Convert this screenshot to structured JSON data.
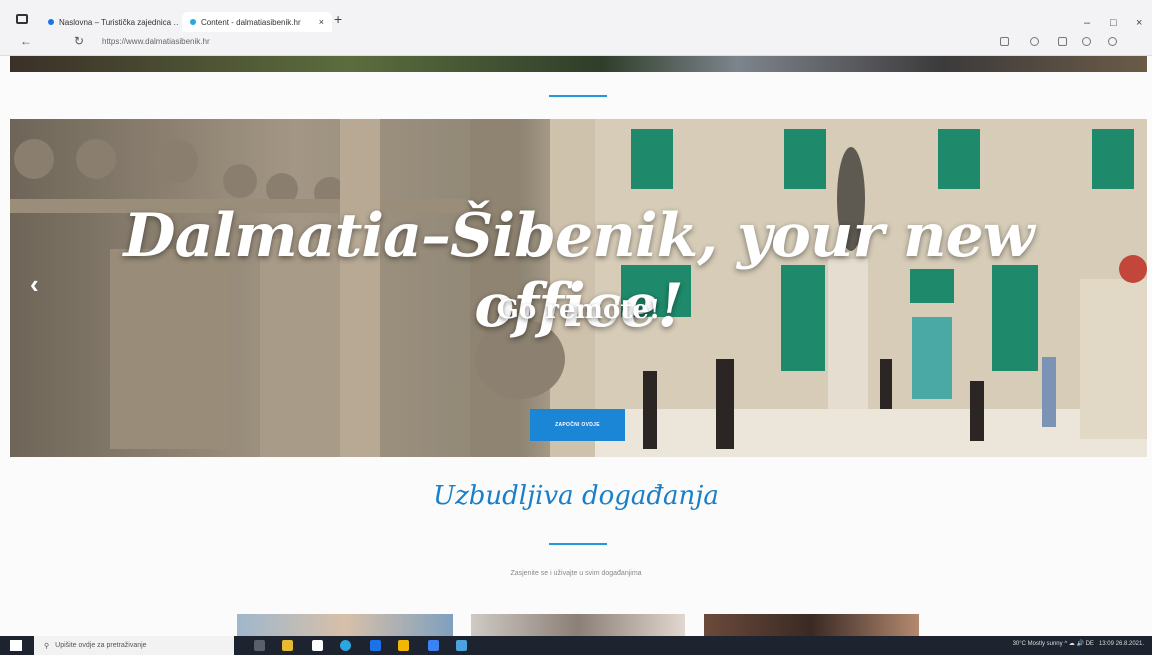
{
  "browser": {
    "tabs": [
      {
        "label": "Naslovna – Turistička zajednica …"
      },
      {
        "label": "Content - dalmatiasibenik.hr"
      }
    ],
    "url": "https://www.dalmatiasibenik.hr",
    "new_tab": "+",
    "window_controls": {
      "minimize": "–",
      "maximize": "□",
      "close": "×"
    }
  },
  "hero": {
    "title": "Dalmatia–Šibenik, your new office!",
    "subtitle": "Go remote!",
    "cta_label": "ZAPOČNI OVDJE",
    "prev_arrow": "‹"
  },
  "section": {
    "title": "Uzbudljiva događanja",
    "subtitle": "Zasjenite se i uživajte u svim događanjima"
  },
  "taskbar": {
    "search_placeholder": "Upišite ovdje za pretraživanje",
    "tray": "30°C  Mostly sunny  ^  ☁  🔊  DE",
    "time": "13:09",
    "date": "26.8.2021."
  },
  "colors": {
    "accent": "#1c86d6",
    "taskbar": "#1e2330"
  }
}
